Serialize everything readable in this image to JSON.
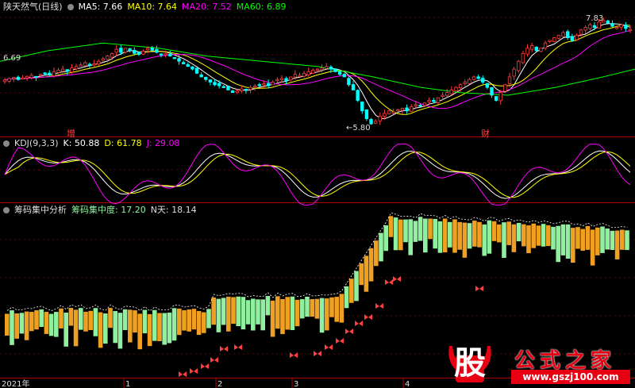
{
  "panel1": {
    "title": "陕天然气(日线)",
    "ma5": "MA5: 7.66",
    "ma10": "MA10: 7.64",
    "ma20": "MA20: 7.52",
    "ma60": "MA60: 6.89",
    "low_label": "←5.80",
    "high_label": "7.83",
    "left_price": "6.69",
    "zeng_label": "增",
    "cai_label": "财"
  },
  "panel2": {
    "title": "KDJ(9,3,3)",
    "k": "K: 50.88",
    "d": "D: 61.78",
    "j": "J: 29.08"
  },
  "panel3": {
    "title": "筹码集中分析",
    "conc": "筹码集中度: 17.20",
    "n": "N天: 18.14"
  },
  "axis": {
    "labels": [
      "2021年",
      "1",
      "2",
      "3",
      "4"
    ]
  },
  "logo": {
    "glyph": "股",
    "text": "公式之家",
    "url": "www.gszj100.com"
  },
  "colors": {
    "up": "#ff3c3c",
    "down": "#00ffff",
    "ma5": "#ffffff",
    "ma10": "#ffff00",
    "ma20": "#ff00ff",
    "ma60": "#00ff00",
    "bar_green": "#90f0a0",
    "bar_orange": "#f0a020",
    "marker": "#ff4040"
  },
  "chart_data": [
    {
      "type": "candlestick",
      "title": "陕天然气(日线)",
      "series": [
        {
          "name": "MA5",
          "value": 7.66
        },
        {
          "name": "MA10",
          "value": 7.64
        },
        {
          "name": "MA20",
          "value": 7.52
        },
        {
          "name": "MA60",
          "value": 6.89
        }
      ],
      "annotations": [
        "←5.80",
        "7.83",
        "6.69"
      ],
      "close": [
        6.69,
        6.72,
        6.74,
        6.7,
        6.73,
        6.76,
        6.78,
        6.75,
        6.8,
        6.82,
        6.79,
        6.85,
        6.88,
        6.9,
        6.86,
        6.92,
        6.95,
        6.98,
        7.02,
        6.97,
        7.0,
        7.05,
        7.1,
        7.15,
        7.2,
        7.28,
        7.22,
        7.3,
        7.25,
        7.2,
        7.18,
        7.24,
        7.3,
        7.26,
        7.22,
        7.18,
        7.2,
        7.15,
        7.1,
        7.05,
        7.0,
        6.95,
        6.9,
        6.82,
        6.75,
        6.7,
        6.65,
        6.6,
        6.58,
        6.55,
        6.5,
        6.45,
        6.48,
        6.52,
        6.5,
        6.55,
        6.58,
        6.6,
        6.62,
        6.58,
        6.65,
        6.7,
        6.72,
        6.68,
        6.75,
        6.8,
        6.78,
        6.82,
        6.85,
        6.88,
        6.9,
        6.92,
        6.95,
        6.9,
        6.85,
        6.8,
        6.75,
        6.6,
        6.5,
        6.3,
        6.1,
        5.95,
        5.85,
        5.9,
        6.0,
        6.05,
        6.1,
        6.08,
        6.12,
        6.15,
        6.1,
        6.18,
        6.22,
        6.2,
        6.25,
        6.3,
        6.28,
        6.35,
        6.4,
        6.45,
        6.5,
        6.55,
        6.6,
        6.65,
        6.7,
        6.75,
        6.72,
        6.65,
        6.55,
        6.4,
        6.3,
        6.45,
        6.6,
        6.75,
        6.9,
        7.05,
        7.2,
        7.3,
        7.35,
        7.25,
        7.3,
        7.4,
        7.45,
        7.5,
        7.55,
        7.6,
        7.5,
        7.45,
        7.55,
        7.65,
        7.7,
        7.75,
        7.7,
        7.8,
        7.83,
        7.78,
        7.72,
        7.7,
        7.75,
        7.68,
        7.66
      ]
    },
    {
      "type": "line",
      "title": "KDJ(9,3,3)",
      "series": [
        {
          "name": "K",
          "value": 50.88
        },
        {
          "name": "D",
          "value": 61.78
        },
        {
          "name": "J",
          "value": 29.08
        }
      ]
    },
    {
      "type": "bar",
      "title": "筹码集中分析",
      "series": [
        {
          "name": "筹码集中度",
          "value": 17.2
        },
        {
          "name": "N天",
          "value": 18.14
        }
      ]
    }
  ]
}
